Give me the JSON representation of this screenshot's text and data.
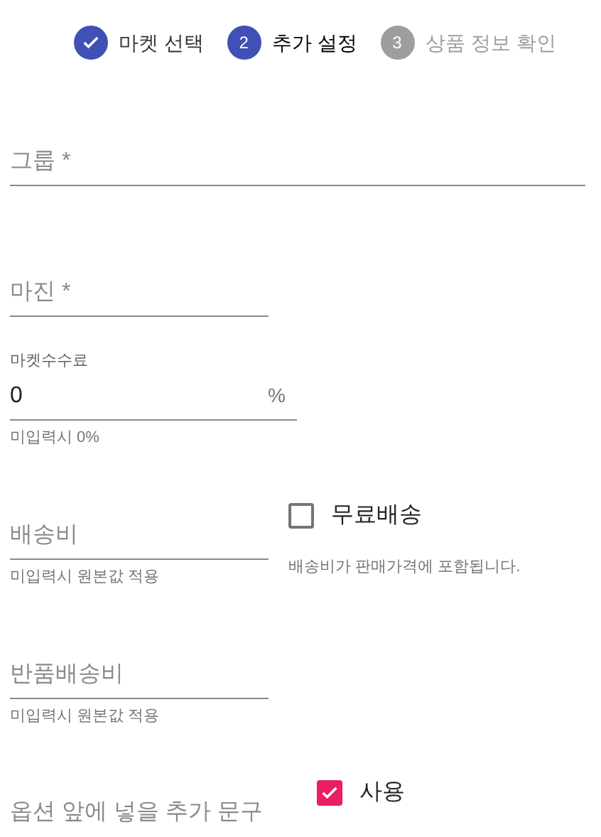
{
  "stepper": [
    {
      "label": "마켓 선택",
      "completed": true,
      "selected": false
    },
    {
      "label": "추가 설정",
      "number": "2",
      "completed": false,
      "selected": true
    },
    {
      "label": "상품 정보 확인",
      "number": "3",
      "completed": false,
      "selected": false
    }
  ],
  "group_field": {
    "placeholder": "그룹 *"
  },
  "margin_field": {
    "placeholder": "마진 *"
  },
  "fee_field": {
    "label": "마켓수수료",
    "value": "0",
    "suffix": "%",
    "helper": "미입력시 0%"
  },
  "shipping_field": {
    "placeholder": "배송비",
    "helper": "미입력시 원본값 적용"
  },
  "free_shipping": {
    "label": "무료배송",
    "checked": false,
    "helper": "배송비가 판매가격에 포함됩니다."
  },
  "return_shipping_field": {
    "placeholder": "반품배송비",
    "helper": "미입력시 원본값 적용"
  },
  "option_prefix_field": {
    "placeholder": "옵션 앞에 넣을 추가 문구"
  },
  "use_option_prefix": {
    "label": "사용",
    "checked": true
  }
}
